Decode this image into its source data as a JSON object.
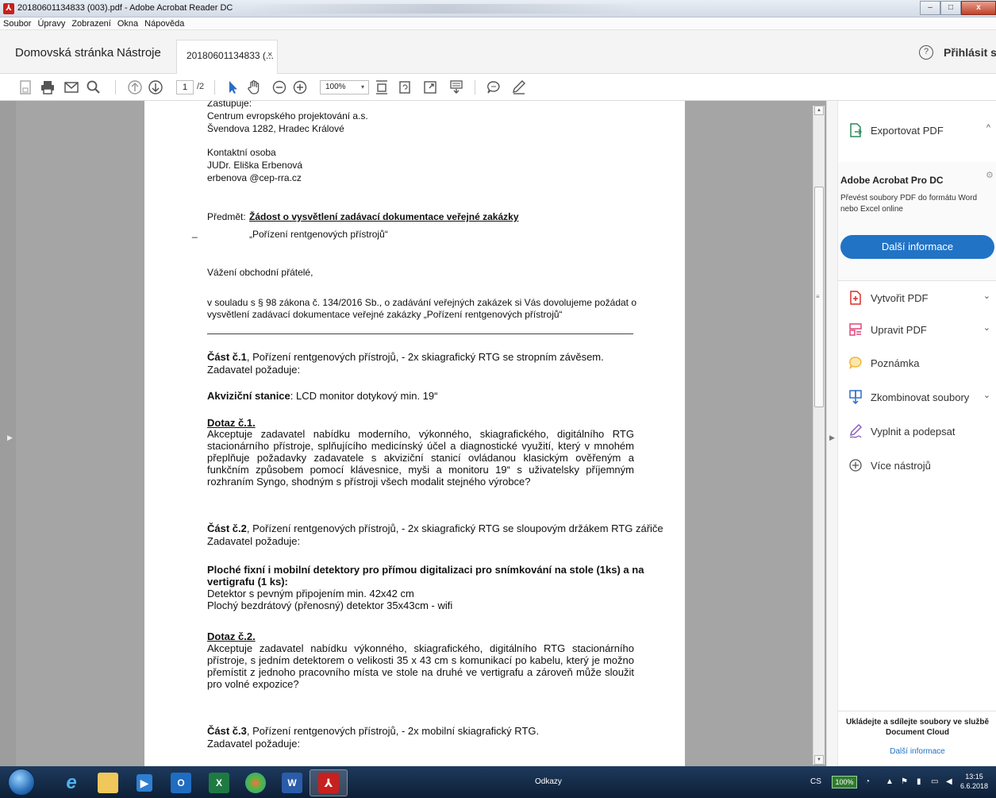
{
  "window": {
    "title": "20180601134833 (003).pdf - Adobe Acrobat Reader DC",
    "icon": "acrobat-icon"
  },
  "menu": [
    "Soubor",
    "Úpravy",
    "Zobrazení",
    "Okna",
    "Nápověda"
  ],
  "tabs": {
    "home": "Domovská stránka",
    "tools": "Nástroje",
    "document": "20180601134833 (...",
    "close": "×",
    "help": "?",
    "signin": "Přihlásit se"
  },
  "toolbar": {
    "page_current": "1",
    "page_total": "/2",
    "zoom": "100%",
    "zoom_arrow": "▾"
  },
  "document": {
    "lines": {
      "zastupuje": "Zastupuje:",
      "org": "Centrum evropského projektování a.s.",
      "address": "Švendova 1282, Hradec Králové",
      "contact_label": "Kontaktní osoba",
      "contact_name": "JUDr. Eliška Erbenová",
      "contact_email": "erbenova @cep-rra.cz",
      "subject_label": "Předmět:",
      "subject": "Žádost o vysvětlení zadávací dokumentace veřejné zakázky",
      "dash": "_",
      "project": "„Pořízení rentgenových přístrojů“",
      "greeting": "Vážení obchodní přátelé,",
      "intro_1": "v souladu s § 98 zákona č. 134/2016 Sb., o zadávání veřejných zakázek si Vás dovolujeme požádat o",
      "intro_2": "vysvětlení zadávací dokumentace veřejné zakázky  „Pořízení rentgenových přístrojů“",
      "part1_bold": "Část č.1",
      "part1_rest": ", Pořízení rentgenových přístrojů, - 2x skiagrafický RTG se stropním závěsem.",
      "requires_1": "Zadavatel požaduje:",
      "station_bold": "Akviziční stanice",
      "station_rest": ":  LCD monitor dotykový min. 19“",
      "q1_title": "Dotaz č.1.",
      "q1_text": "Akceptuje zadavatel nabídku moderního, výkonného, skiagrafického, digitálního RTG stacionárního přístroje, splňujícího medicínský účel a diagnostické využití, který v mnohém přeplňuje požadavky zadavatele s akviziční stanicí ovládanou klasickým ověřeným a funkčním způsobem pomocí klávesnice, myši a monitoru 19“ s uživatelsky příjemným rozhraním Syngo, shodným s přístroji všech modalit stejného výrobce?",
      "part2_bold": "Část č.2",
      "part2_rest": ", Pořízení rentgenových přístrojů, - 2x skiagrafický RTG se sloupovým držákem RTG zářiče",
      "requires_2": "Zadavatel požaduje:",
      "detectors_1": "Ploché fixní i mobilní detektory pro přímou digitalizaci pro snímkování na stole (1ks) a na",
      "detectors_2": "vertigrafu (1 ks):",
      "detector_a": "Detektor s pevným připojením min. 42x42 cm",
      "detector_b": "Plochý bezdrátový (přenosný) detektor  35x43cm - wifi",
      "q2_title": "Dotaz č.2.",
      "q2_text": "Akceptuje zadavatel nabídku výkonného, skiagrafického, digitálního RTG stacionárního přístroje, s jedním detektorem o velikosti 35 x 43 cm s komunikací po kabelu, který je možno přemístit z jednoho pracovního místa ve stole na druhé ve vertigrafu a zároveň může sloužit pro volné expozice?",
      "part3_bold": "Část č.3",
      "part3_rest": ", Pořízení rentgenových přístrojů, - 2x mobilní skiagrafický RTG.",
      "requires_3": "Zadavatel požaduje:"
    }
  },
  "right_panel": {
    "export_pdf": "Exportovat PDF",
    "promo_title": "Adobe Acrobat Pro DC",
    "promo_desc": "Převést soubory PDF do formátu Word nebo Excel online",
    "promo_button": "Další informace",
    "tools": [
      {
        "label": "Vytvořit PDF",
        "icon": "create-pdf-icon",
        "color": "#d9302c"
      },
      {
        "label": "Upravit PDF",
        "icon": "edit-pdf-icon",
        "color": "#e0467a"
      },
      {
        "label": "Poznámka",
        "icon": "comment-icon",
        "color": "#f2b632"
      },
      {
        "label": "Zkombinovat soubory",
        "icon": "combine-files-icon",
        "color": "#2f6fc8"
      },
      {
        "label": "Vyplnit a podepsat",
        "icon": "fill-sign-icon",
        "color": "#8a5cc4"
      },
      {
        "label": "Více nástrojů",
        "icon": "more-tools-icon",
        "color": "#555555"
      }
    ],
    "footer_title": "Ukládejte a sdílejte soubory ve službě Document Cloud",
    "footer_link": "Další informace"
  },
  "taskbar": {
    "links": "Odkazy",
    "language": "CS",
    "battery": "100%",
    "time": "13:15",
    "date": "6.6.2018"
  }
}
